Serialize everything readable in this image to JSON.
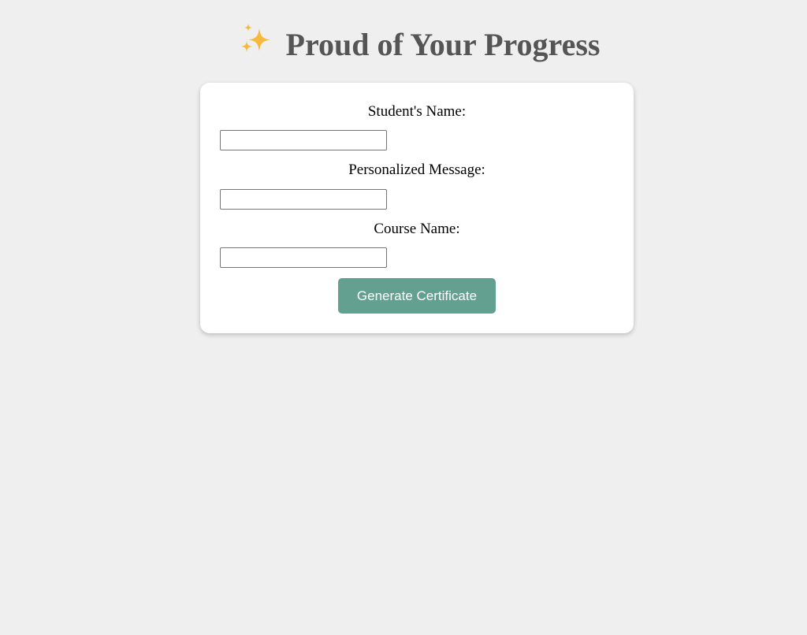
{
  "header": {
    "title": "Proud of Your Progress",
    "icon": "sparkles-icon"
  },
  "form": {
    "student_name": {
      "label": "Student's Name:",
      "value": "",
      "placeholder": ""
    },
    "personalized_message": {
      "label": "Personalized Message:",
      "value": "",
      "placeholder": ""
    },
    "course_name": {
      "label": "Course Name:",
      "value": "",
      "placeholder": ""
    },
    "submit_label": "Generate Certificate"
  },
  "colors": {
    "background": "#efefef",
    "card": "#ffffff",
    "title_text": "#555555",
    "button": "#64a08f",
    "button_text": "#ffffff",
    "sparkle": "#f6b93b"
  }
}
